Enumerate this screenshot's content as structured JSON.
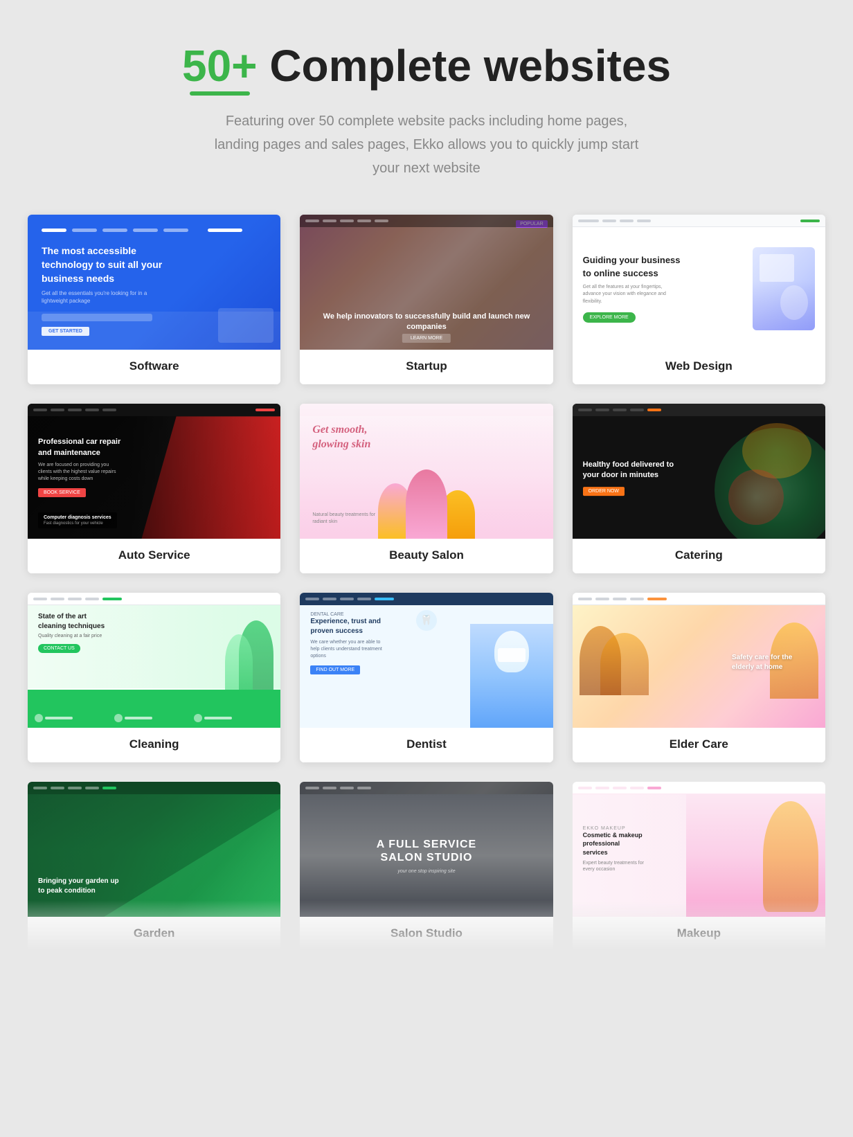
{
  "header": {
    "accent": "50+",
    "title_rest": " Complete websites",
    "subtitle": "Featuring over 50 complete website packs including home pages,\nlanding pages and sales pages, Ekko allows you to quickly\njump start your next website",
    "accent_color": "#3cb54a"
  },
  "cards": [
    {
      "id": "software",
      "label": "Software",
      "thumb_headline": "The most accessible technology to suit all your business needs",
      "bg_color": "#2563eb"
    },
    {
      "id": "startup",
      "label": "Startup",
      "thumb_headline": "We help innovators to successfully build and launch new companies",
      "bg_color": "#7c3aed"
    },
    {
      "id": "webdesign",
      "label": "Web Design",
      "thumb_headline": "Guiding your business to online success",
      "bg_color": "#ffffff"
    },
    {
      "id": "auto",
      "label": "Auto Service",
      "thumb_headline": "Professional car repair and maintenance",
      "bg_color": "#1a1a1a"
    },
    {
      "id": "beauty",
      "label": "Beauty Salon",
      "thumb_headline": "Get smooth, glowing skin",
      "bg_color": "#fff0f6"
    },
    {
      "id": "catering",
      "label": "Catering",
      "thumb_headline": "Healthy food delivered to your door in minutes",
      "bg_color": "#111"
    },
    {
      "id": "cleaning",
      "label": "Cleaning",
      "thumb_headline": "State of the art cleaning techniques",
      "bg_color": "#ffffff"
    },
    {
      "id": "dentist",
      "label": "Dentist",
      "thumb_headline": "Experience, trust and proven success",
      "bg_color": "#f0f9ff"
    },
    {
      "id": "eldercare",
      "label": "Elder Care",
      "thumb_headline": "Safety care for the elderly at home",
      "bg_color": "#fafafa"
    },
    {
      "id": "garden",
      "label": "Garden",
      "thumb_headline": "Bringing your garden up to peak condition",
      "bg_color": "#166534"
    },
    {
      "id": "salon",
      "label": "Salon Studio",
      "thumb_headline": "A Full Service Salon Studio",
      "bg_color": "#1a1a1a"
    },
    {
      "id": "makeup",
      "label": "Makeup",
      "thumb_headline": "Cosmetic & makeup professional services",
      "bg_color": "#f9f9f9"
    }
  ]
}
